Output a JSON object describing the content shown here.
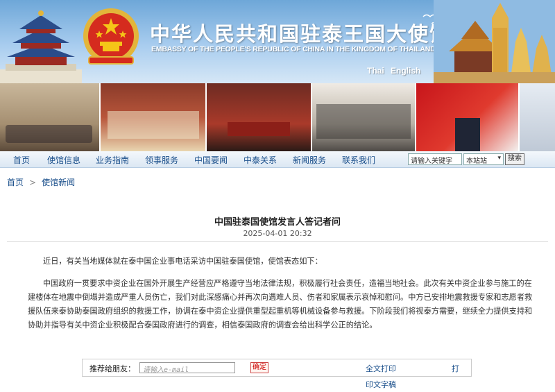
{
  "header": {
    "title_cn": "中华人民共和国驻泰王国大使馆",
    "title_en": "EMBASSY OF THE PEOPLE'S REPUBLIC OF CHINA IN THE KINGDOM OF THAILAND",
    "lang_thai": "Thai",
    "lang_english": "English"
  },
  "nav": {
    "items": [
      "首页",
      "使馆信息",
      "业务指南",
      "领事服务",
      "中国要闻",
      "中泰关系",
      "新闻服务",
      "联系我们"
    ],
    "search_placeholder": "请输入关键字",
    "search_scope": "本站站",
    "search_button": "搜索"
  },
  "breadcrumb": {
    "home": "首页",
    "sep": ">",
    "current": "使馆新闻"
  },
  "article": {
    "title": "中国驻泰国使馆发言人答记者问",
    "date": "2025-04-01 20:32",
    "paragraphs": [
      "近日，有关当地媒体就在泰中国企业事电话采访中国驻泰国使馆，使馆表态如下：",
      "中国政府一贯要求中资企业在国外开展生产经营应严格遵守当地法律法规，积极履行社会责任，造福当地社会。此次有关中资企业参与施工的在建楼体在地震中倒塌并造成严重人员伤亡，我们对此深感痛心并再次向遇难人员、伤者和家属表示哀悼和慰问。中方已安排地震救援专家和志愿者救援队伍来泰协助泰国政府组织的救援工作，协调在泰中资企业提供重型起重机等机械设备参与救援。下阶段我们将视泰方需要，继续全力提供支持和协助并指导有关中资企业积极配合泰国政府进行的调查，相信泰国政府的调查会给出科学公正的结论。"
    ]
  },
  "share": {
    "label": "推荐给朋友：",
    "email_placeholder": "请输入e-mail",
    "confirm": "确定",
    "print_full": "全文打印",
    "print_short": "打",
    "print_sub": "印文字稿"
  },
  "colors": {
    "sky": "#6ea7d8",
    "nav_text": "#1a4f8b",
    "emblem_red": "#d52b1e",
    "emblem_gold": "#f5c518"
  }
}
